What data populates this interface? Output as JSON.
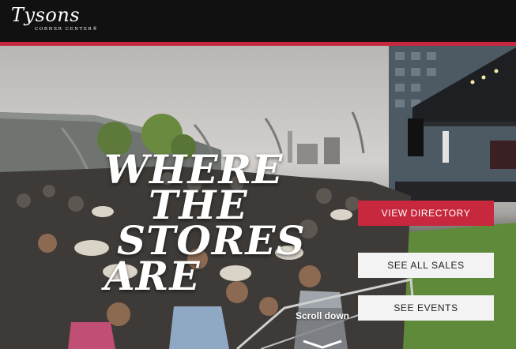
{
  "brand": {
    "logo_script": "Tysons",
    "logo_sub": "CORNER CENTER®"
  },
  "hero": {
    "headline": [
      "WHERE",
      "THE",
      "STORES",
      "ARE"
    ]
  },
  "actions": {
    "view_directory": "VIEW DIRECTORY",
    "see_all_sales": "SEE ALL SALES",
    "see_events": "SEE EVENTS"
  },
  "scroll": {
    "label": "Scroll down"
  },
  "colors": {
    "accent": "#c8283d",
    "topbar": "#111111",
    "button_light": "#f3f3f3"
  }
}
